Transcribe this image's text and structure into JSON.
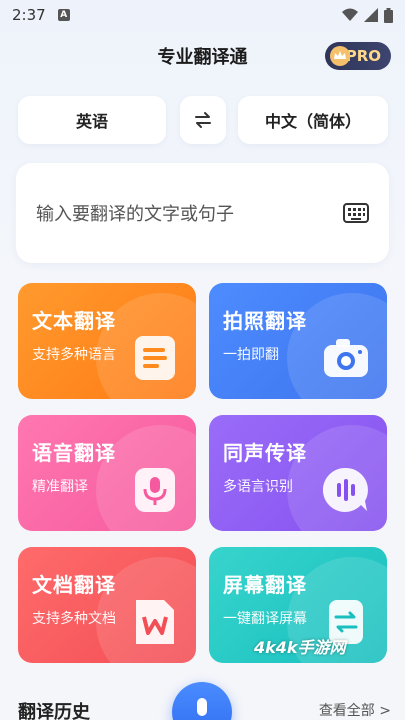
{
  "status_bar": {
    "time": "2:37",
    "notif_letter": "A"
  },
  "header": {
    "title": "专业翻译通",
    "pro_label": "PRO"
  },
  "languages": {
    "source": "英语",
    "target": "中文（简体）"
  },
  "input": {
    "placeholder": "输入要翻译的文字或句子"
  },
  "cards": [
    {
      "title": "文本翻译",
      "subtitle": "支持多种语言"
    },
    {
      "title": "拍照翻译",
      "subtitle": "一拍即翻"
    },
    {
      "title": "语音翻译",
      "subtitle": "精准翻译"
    },
    {
      "title": "同声传译",
      "subtitle": "多语言识别"
    },
    {
      "title": "文档翻译",
      "subtitle": "支持多种文档"
    },
    {
      "title": "屏幕翻译",
      "subtitle": "一键翻译屏幕"
    }
  ],
  "watermark": "4k4k手游网",
  "history": {
    "title": "翻译历史",
    "view_all": "查看全部 >"
  },
  "colors": {
    "primary": "#3e74ee",
    "pro_bg": "#2f3558",
    "pro_text": "#ffd78a"
  }
}
